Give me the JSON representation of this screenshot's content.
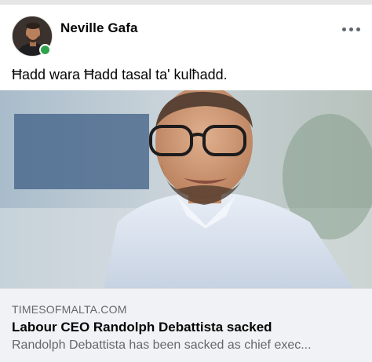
{
  "post": {
    "author": "Neville Gafa",
    "author_online": true,
    "more_icon": "more-horizontal-icon",
    "text": "Ħadd wara Ħadd tasal ta' kulħadd."
  },
  "link_preview": {
    "domain": "TIMESOFMALTA.COM",
    "title": "Labour CEO Randolph Debattista sacked",
    "description": "Randolph Debattista has been sacked as chief exec..."
  },
  "colors": {
    "online": "#31a24c",
    "preview_background": "#f0f2f5",
    "secondary_text": "#65676b",
    "primary_text": "#050505"
  }
}
